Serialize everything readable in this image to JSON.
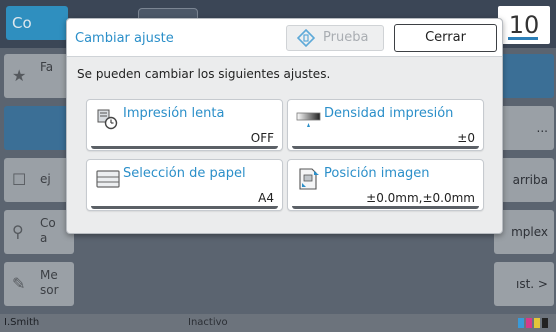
{
  "background": {
    "top_tab": "Co",
    "counter": "10",
    "left_buttons": [
      {
        "label": "Fa",
        "icon": "folder-star-icon"
      },
      {
        "label": "",
        "icon": ""
      },
      {
        "label": "ej",
        "icon": "checkbox-icon"
      },
      {
        "label": "Co\na",
        "icon": "search-icon"
      },
      {
        "label": "Me\nsor",
        "icon": "wrench-icon"
      }
    ],
    "right_buttons": [
      "",
      "...",
      "arriba",
      "mplex",
      "ıst.  >"
    ],
    "status_user": "I.Smith",
    "status_mid": "Inactivo"
  },
  "dialog": {
    "title": "Cambiar ajuste",
    "test_button": "Prueba",
    "close_button": "Cerrar",
    "message": "Se pueden cambiar los siguientes ajustes.",
    "tiles": [
      {
        "label": "Impresión lenta",
        "value": "OFF",
        "icon": "slow-print-icon"
      },
      {
        "label": "Densidad impresión",
        "value": "±0",
        "icon": "density-icon"
      },
      {
        "label": "Selección de papel",
        "value": "A4",
        "icon": "paper-tray-icon"
      },
      {
        "label": "Posición imagen",
        "value": "±0.0mm,±0.0mm",
        "icon": "image-position-icon"
      }
    ]
  },
  "colors": {
    "accent": "#2b8fc9",
    "dim_background": "#5b6470"
  }
}
